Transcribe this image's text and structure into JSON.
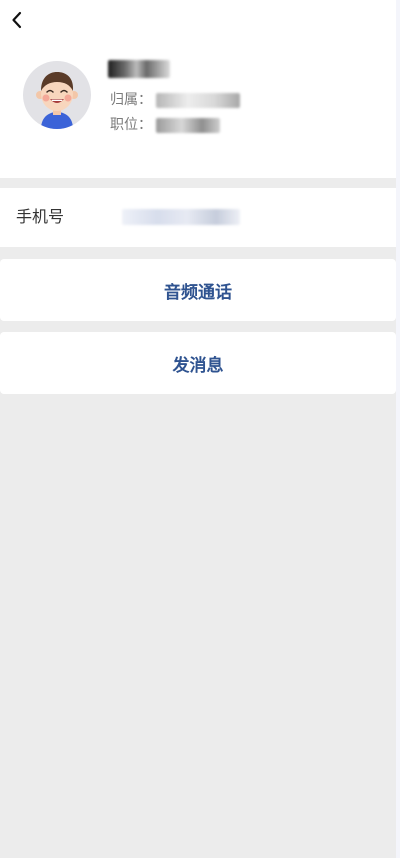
{
  "nav": {
    "back_icon": "chevron-left-icon"
  },
  "profile": {
    "avatar_icon": "cartoon-boy-avatar-icon",
    "name": "",
    "belong_label": "归属：",
    "belong_value": "",
    "position_label": "职位：",
    "position_value": ""
  },
  "phone": {
    "label": "手机号",
    "value": ""
  },
  "actions": {
    "audio_call_label": "音频通话",
    "send_message_label": "发消息"
  },
  "colors": {
    "accent": "#2f5390",
    "page_background": "#ececec",
    "card_background": "#ffffff"
  }
}
